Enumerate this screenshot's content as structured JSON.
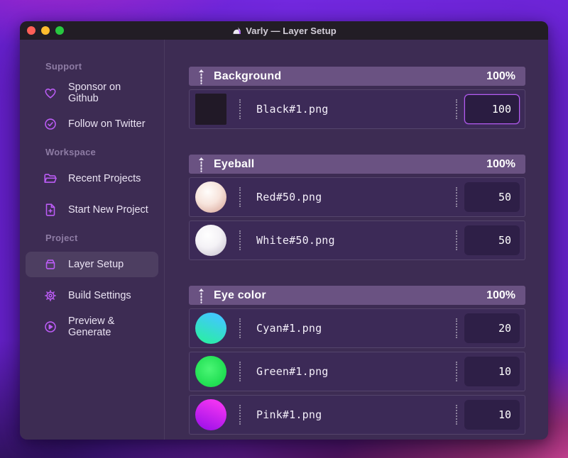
{
  "window": {
    "title": "Varly — Layer Setup",
    "app_icon": "unicorn-icon",
    "traffic_lights": [
      {
        "name": "close",
        "color": "#ff5f57"
      },
      {
        "name": "minimize",
        "color": "#febc2e"
      },
      {
        "name": "zoom",
        "color": "#28c840"
      }
    ]
  },
  "sidebar": {
    "sections": [
      {
        "label": "Support",
        "items": [
          {
            "icon": "heart-icon",
            "label": "Sponsor on Github",
            "active": false
          },
          {
            "icon": "badge-check-icon",
            "label": "Follow on Twitter",
            "active": false
          }
        ]
      },
      {
        "label": "Workspace",
        "items": [
          {
            "icon": "folder-icon",
            "label": "Recent Projects",
            "active": false
          },
          {
            "icon": "file-plus-icon",
            "label": "Start New Project",
            "active": false
          }
        ]
      },
      {
        "label": "Project",
        "items": [
          {
            "icon": "archive-icon",
            "label": "Layer Setup",
            "active": true
          },
          {
            "icon": "gear-icon",
            "label": "Build Settings",
            "active": false
          },
          {
            "icon": "play-circle-icon",
            "label": "Preview & Generate",
            "active": false
          }
        ]
      }
    ]
  },
  "layers": {
    "groups": [
      {
        "name": "Background",
        "weight": "100%",
        "items": [
          {
            "file": "Black#1.png",
            "value": "100",
            "focused": true,
            "thumb": {
              "shape": "square",
              "colors": [
                "#211927"
              ]
            }
          }
        ]
      },
      {
        "name": "Eyeball",
        "weight": "100%",
        "items": [
          {
            "file": "Red#50.png",
            "value": "50",
            "focused": false,
            "thumb": {
              "shape": "sphere",
              "colors": [
                "#fffdfb",
                "#f7e4dc",
                "#e3bcb1",
                "#a9837a"
              ]
            }
          },
          {
            "file": "White#50.png",
            "value": "50",
            "focused": false,
            "thumb": {
              "shape": "sphere",
              "colors": [
                "#ffffff",
                "#f4f2f6",
                "#d8d3de",
                "#b1aabc"
              ]
            }
          }
        ]
      },
      {
        "name": "Eye color",
        "weight": "100%",
        "items": [
          {
            "file": "Cyan#1.png",
            "value": "20",
            "focused": false,
            "thumb": {
              "shape": "circle-linear",
              "colors": [
                "#41c9fa",
                "#2cecaa"
              ]
            }
          },
          {
            "file": "Green#1.png",
            "value": "10",
            "focused": false,
            "thumb": {
              "shape": "circle-radial",
              "colors": [
                "#4bf675",
                "#23e055",
                "#1ec94a"
              ]
            }
          },
          {
            "file": "Pink#1.png",
            "value": "10",
            "focused": false,
            "thumb": {
              "shape": "circle-linear",
              "colors": [
                "#ee32f2",
                "#a514ea"
              ]
            }
          }
        ]
      }
    ]
  },
  "colors": {
    "accent": "#bc5cf6",
    "focus_border": "#b55bf3",
    "group_header_bg": "#6a5282",
    "row_bg": "#3c2a57",
    "window_bg": "#3d2c53",
    "titlebar_bg": "#221d25"
  }
}
